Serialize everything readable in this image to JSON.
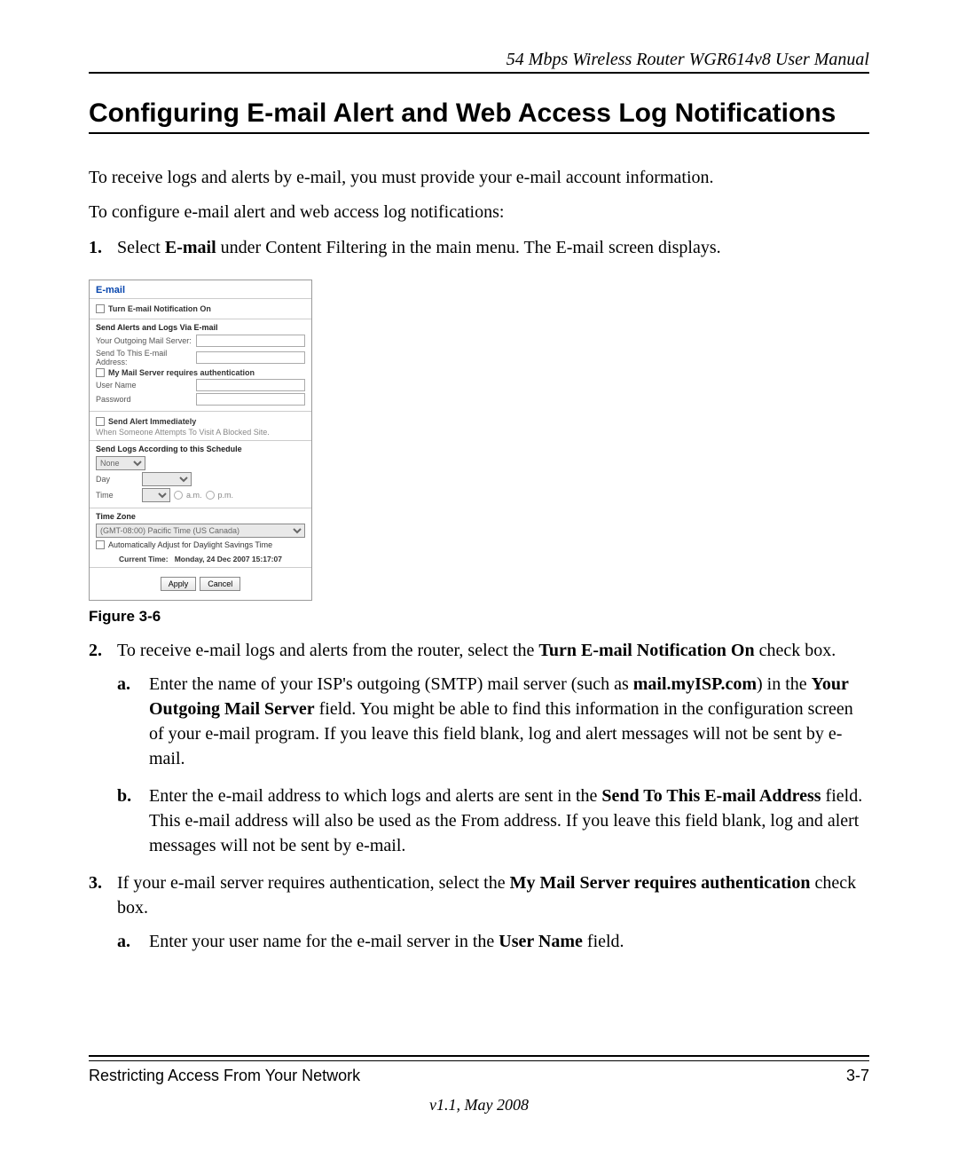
{
  "header": {
    "running": "54 Mbps Wireless Router WGR614v8 User Manual"
  },
  "title": "Configuring E-mail Alert and Web Access Log Notifications",
  "intro": {
    "p1": "To receive logs and alerts by e-mail, you must provide your e-mail account information.",
    "p2": "To configure e-mail alert and web access log notifications:"
  },
  "steps": {
    "s1": {
      "marker": "1.",
      "pre": "Select ",
      "bold": "E-mail",
      "post": " under Content Filtering in the main menu. The E-mail screen displays."
    },
    "s2": {
      "marker": "2.",
      "pre": "To receive e-mail logs and alerts from the router, select the ",
      "bold": "Turn E-mail Notification On",
      "post": " check box.",
      "a": {
        "marker": "a.",
        "t1": "Enter the name of your ISP's outgoing (SMTP) mail server (such as ",
        "b1": "mail.myISP.com",
        "t2": ") in the ",
        "b2": "Your Outgoing Mail Server",
        "t3": " field. You might be able to find this information in the configuration screen of your e-mail program. If you leave this field blank, log and alert messages will not be sent by e-mail."
      },
      "b": {
        "marker": "b.",
        "t1": "Enter the e-mail address to which logs and alerts are sent in the ",
        "b1": "Send To This E-mail Address",
        "t2": " field. This e-mail address will also be used as the From address. If you leave this field blank, log and alert messages will not be sent by e-mail."
      }
    },
    "s3": {
      "marker": "3.",
      "t1": "If your e-mail server requires authentication, select the ",
      "b1": "My Mail Server requires authentication",
      "t2": " check box.",
      "a": {
        "marker": "a.",
        "t1": "Enter your user name for the e-mail server in the ",
        "b1": "User Name",
        "t2": " field."
      }
    }
  },
  "figure": {
    "caption": "Figure 3-6",
    "panel": {
      "title": "E-mail",
      "notify": {
        "label": "Turn E-mail Notification On"
      },
      "send_section": {
        "head": "Send Alerts and Logs Via E-mail",
        "outgoing_label": "Your Outgoing Mail Server:",
        "sendto_label": "Send To This E-mail Address:",
        "auth_label": "My Mail Server requires authentication",
        "user_label": "User Name",
        "pass_label": "Password"
      },
      "alert_section": {
        "head": "Send Alert Immediately",
        "sub": "When Someone Attempts To Visit A Blocked Site."
      },
      "schedule": {
        "head": "Send Logs According to this Schedule",
        "freq": "None",
        "day_label": "Day",
        "time_label": "Time",
        "am": "a.m.",
        "pm": "p.m."
      },
      "tz": {
        "head": "Time Zone",
        "zone": "(GMT-08:00) Pacific Time (US Canada)",
        "dst": "Automatically Adjust for Daylight Savings Time",
        "current_label": "Current Time:",
        "current_value": "Monday, 24 Dec 2007 15:17:07"
      },
      "buttons": {
        "apply": "Apply",
        "cancel": "Cancel"
      }
    }
  },
  "footer": {
    "left": "Restricting Access From Your Network",
    "right": "3-7",
    "version": "v1.1, May 2008"
  }
}
